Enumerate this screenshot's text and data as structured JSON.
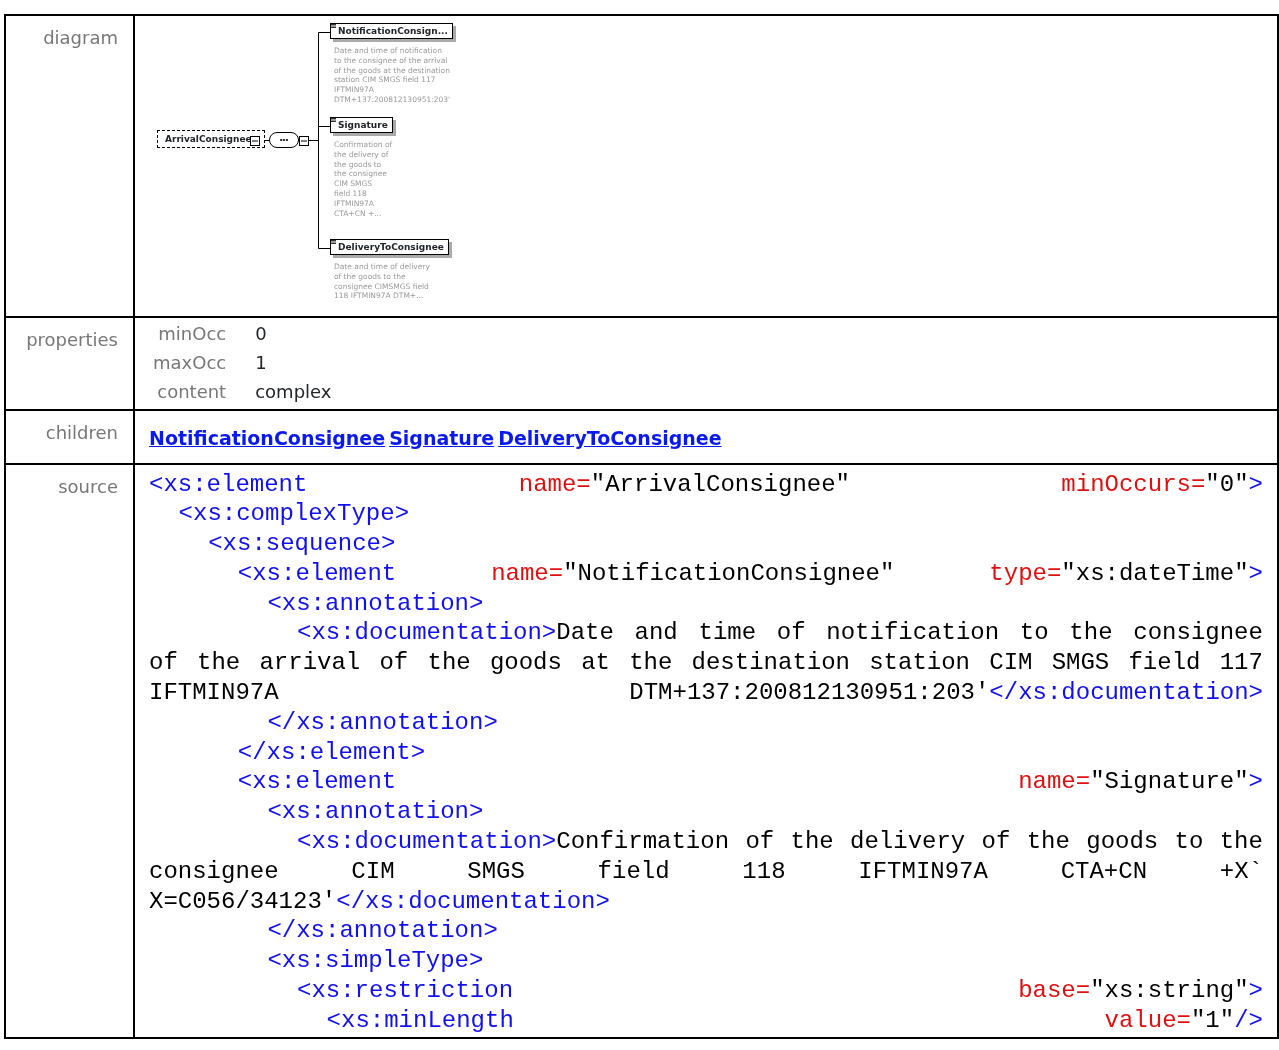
{
  "rows": [
    {
      "label": "diagram",
      "kind": "diagram",
      "diagram": {
        "root": {
          "name": "ArrivalConsignee"
        },
        "compositor": {
          "symbol": "•••"
        },
        "children": [
          {
            "name": "NotificationConsign...",
            "description_lines": [
              "Date and time of notification",
              "to the consignee of the arrival",
              "of the goods at the destination",
              "station CIM SMGS field 117",
              "IFTMIN97A",
              "DTM+137:200812130951:203'"
            ]
          },
          {
            "name": "Signature",
            "description_lines": [
              "Confirmation of",
              "the delivery of",
              "the goods to",
              "the consignee",
              "CIM SMGS",
              "field 118",
              "IFTMIN97A",
              "CTA+CN +..."
            ]
          },
          {
            "name": "DeliveryToConsignee",
            "description_lines": [
              "Date and time of delivery",
              "of the goods to the",
              "consignee CIMSMGS field",
              "118 IFTMIN97A DTM+..."
            ]
          }
        ]
      }
    },
    {
      "label": "properties",
      "kind": "properties",
      "properties": [
        {
          "name": "minOcc",
          "value": "0"
        },
        {
          "name": "maxOcc",
          "value": "1"
        },
        {
          "name": "content",
          "value": "complex"
        }
      ]
    },
    {
      "label": "children",
      "kind": "links",
      "links": [
        "NotificationConsignee",
        "Signature",
        "DeliveryToConsignee"
      ]
    },
    {
      "label": "source",
      "kind": "source",
      "source": {
        "head": [
          {
            "justify": true,
            "words": [
              [
                {
                  "kind": "tag",
                  "text": "<xs:element"
                }
              ],
              [
                {
                  "kind": "attr",
                  "text": "name="
                },
                {
                  "kind": "val",
                  "text": "\"ArrivalConsignee\""
                }
              ],
              [
                {
                  "kind": "attr",
                  "text": "minOccurs="
                },
                {
                  "kind": "val",
                  "text": "\"0\""
                },
                {
                  "kind": "tag",
                  "text": ">"
                }
              ]
            ]
          }
        ],
        "children": [
          {
            "head": [
              {
                "words": [
                  [
                    {
                      "kind": "tag",
                      "text": "<xs:complexType>"
                    }
                  ]
                ]
              }
            ],
            "children": [
              {
                "head": [
                  {
                    "words": [
                      [
                        {
                          "kind": "tag",
                          "text": "<xs:sequence>"
                        }
                      ]
                    ]
                  }
                ],
                "children": [
                  {
                    "head": [
                      {
                        "justify": true,
                        "words": [
                          [
                            {
                              "kind": "tag",
                              "text": "<xs:element"
                            }
                          ],
                          [
                            {
                              "kind": "attr",
                              "text": "name="
                            },
                            {
                              "kind": "val",
                              "text": "\"NotificationConsignee\""
                            }
                          ],
                          [
                            {
                              "kind": "attr",
                              "text": "type="
                            },
                            {
                              "kind": "val",
                              "text": "\"xs:dateTime\""
                            },
                            {
                              "kind": "tag",
                              "text": ">"
                            }
                          ]
                        ]
                      }
                    ],
                    "children": [
                      {
                        "head": [
                          {
                            "words": [
                              [
                                {
                                  "kind": "tag",
                                  "text": "<xs:annotation>"
                                }
                              ]
                            ]
                          }
                        ],
                        "children": [
                          {
                            "head": [
                              {
                                "justify": true,
                                "words": [
                                  [
                                    {
                                      "kind": "tag",
                                      "text": "<xs:documentation>"
                                    },
                                    {
                                      "kind": "val",
                                      "text": "Date"
                                    }
                                  ],
                                  [
                                    {
                                      "kind": "val",
                                      "text": "and"
                                    }
                                  ],
                                  [
                                    {
                                      "kind": "val",
                                      "text": "time"
                                    }
                                  ],
                                  [
                                    {
                                      "kind": "val",
                                      "text": "of"
                                    }
                                  ],
                                  [
                                    {
                                      "kind": "val",
                                      "text": "notification"
                                    }
                                  ],
                                  [
                                    {
                                      "kind": "val",
                                      "text": "to"
                                    }
                                  ],
                                  [
                                    {
                                      "kind": "val",
                                      "text": "the"
                                    }
                                  ],
                                  [
                                    {
                                      "kind": "val",
                                      "text": "consignee"
                                    }
                                  ]
                                ],
                                "wraps": [
                                  {
                                    "justify": true,
                                    "words": [
                                      [
                                        {
                                          "kind": "val",
                                          "text": "of"
                                        }
                                      ],
                                      [
                                        {
                                          "kind": "val",
                                          "text": "the"
                                        }
                                      ],
                                      [
                                        {
                                          "kind": "val",
                                          "text": "arrival"
                                        }
                                      ],
                                      [
                                        {
                                          "kind": "val",
                                          "text": "of"
                                        }
                                      ],
                                      [
                                        {
                                          "kind": "val",
                                          "text": "the"
                                        }
                                      ],
                                      [
                                        {
                                          "kind": "val",
                                          "text": "goods"
                                        }
                                      ],
                                      [
                                        {
                                          "kind": "val",
                                          "text": "at"
                                        }
                                      ],
                                      [
                                        {
                                          "kind": "val",
                                          "text": "the"
                                        }
                                      ],
                                      [
                                        {
                                          "kind": "val",
                                          "text": "destination"
                                        }
                                      ],
                                      [
                                        {
                                          "kind": "val",
                                          "text": "station"
                                        }
                                      ],
                                      [
                                        {
                                          "kind": "val",
                                          "text": "CIM"
                                        }
                                      ],
                                      [
                                        {
                                          "kind": "val",
                                          "text": "SMGS"
                                        }
                                      ],
                                      [
                                        {
                                          "kind": "val",
                                          "text": "field"
                                        }
                                      ],
                                      [
                                        {
                                          "kind": "val",
                                          "text": "117"
                                        }
                                      ]
                                    ]
                                  },
                                  {
                                    "justify": true,
                                    "words": [
                                      [
                                        {
                                          "kind": "val",
                                          "text": "IFTMIN97A"
                                        }
                                      ],
                                      [
                                        {
                                          "kind": "val",
                                          "text": "DTM+137:200812130951:203'"
                                        },
                                        {
                                          "kind": "tag",
                                          "text": "</xs:documentation>"
                                        }
                                      ]
                                    ]
                                  }
                                ]
                              }
                            ]
                          }
                        ],
                        "tail": [
                          {
                            "words": [
                              [
                                {
                                  "kind": "tag",
                                  "text": "</xs:annotation>"
                                }
                              ]
                            ]
                          }
                        ]
                      }
                    ],
                    "tail": [
                      {
                        "words": [
                          [
                            {
                              "kind": "tag",
                              "text": "</xs:element>"
                            }
                          ]
                        ]
                      }
                    ]
                  },
                  {
                    "head": [
                      {
                        "justify": true,
                        "words": [
                          [
                            {
                              "kind": "tag",
                              "text": "<xs:element"
                            }
                          ],
                          [
                            {
                              "kind": "attr",
                              "text": "name="
                            },
                            {
                              "kind": "val",
                              "text": "\"Signature\""
                            },
                            {
                              "kind": "tag",
                              "text": ">"
                            }
                          ]
                        ]
                      }
                    ],
                    "children": [
                      {
                        "head": [
                          {
                            "words": [
                              [
                                {
                                  "kind": "tag",
                                  "text": "<xs:annotation>"
                                }
                              ]
                            ]
                          }
                        ],
                        "children": [
                          {
                            "head": [
                              {
                                "justify": true,
                                "words": [
                                  [
                                    {
                                      "kind": "tag",
                                      "text": "<xs:documentation>"
                                    },
                                    {
                                      "kind": "val",
                                      "text": "Confirmation"
                                    }
                                  ],
                                  [
                                    {
                                      "kind": "val",
                                      "text": "of"
                                    }
                                  ],
                                  [
                                    {
                                      "kind": "val",
                                      "text": "the"
                                    }
                                  ],
                                  [
                                    {
                                      "kind": "val",
                                      "text": "delivery"
                                    }
                                  ],
                                  [
                                    {
                                      "kind": "val",
                                      "text": "of"
                                    }
                                  ],
                                  [
                                    {
                                      "kind": "val",
                                      "text": "the"
                                    }
                                  ],
                                  [
                                    {
                                      "kind": "val",
                                      "text": "goods"
                                    }
                                  ],
                                  [
                                    {
                                      "kind": "val",
                                      "text": "to"
                                    }
                                  ],
                                  [
                                    {
                                      "kind": "val",
                                      "text": "the"
                                    }
                                  ]
                                ],
                                "wraps": [
                                  {
                                    "justify": true,
                                    "words": [
                                      [
                                        {
                                          "kind": "val",
                                          "text": "consignee"
                                        }
                                      ],
                                      [
                                        {
                                          "kind": "val",
                                          "text": "CIM"
                                        }
                                      ],
                                      [
                                        {
                                          "kind": "val",
                                          "text": "SMGS"
                                        }
                                      ],
                                      [
                                        {
                                          "kind": "val",
                                          "text": "field"
                                        }
                                      ],
                                      [
                                        {
                                          "kind": "val",
                                          "text": "118"
                                        }
                                      ],
                                      [
                                        {
                                          "kind": "val",
                                          "text": "IFTMIN97A"
                                        }
                                      ],
                                      [
                                        {
                                          "kind": "val",
                                          "text": "CTA+CN"
                                        }
                                      ],
                                      [
                                        {
                                          "kind": "val",
                                          "text": "+X`"
                                        }
                                      ]
                                    ]
                                  },
                                  {
                                    "words": [
                                      [
                                        {
                                          "kind": "val",
                                          "text": "X=C056/34123'"
                                        },
                                        {
                                          "kind": "tag",
                                          "text": "</xs:documentation>"
                                        }
                                      ]
                                    ]
                                  }
                                ]
                              }
                            ]
                          }
                        ],
                        "tail": [
                          {
                            "words": [
                              [
                                {
                                  "kind": "tag",
                                  "text": "</xs:annotation>"
                                }
                              ]
                            ]
                          }
                        ]
                      },
                      {
                        "head": [
                          {
                            "words": [
                              [
                                {
                                  "kind": "tag",
                                  "text": "<xs:simpleType>"
                                }
                              ]
                            ]
                          }
                        ],
                        "children": [
                          {
                            "head": [
                              {
                                "justify": true,
                                "words": [
                                  [
                                    {
                                      "kind": "tag",
                                      "text": "<xs:restriction"
                                    }
                                  ],
                                  [
                                    {
                                      "kind": "attr",
                                      "text": "base="
                                    },
                                    {
                                      "kind": "val",
                                      "text": "\"xs:string\""
                                    },
                                    {
                                      "kind": "tag",
                                      "text": ">"
                                    }
                                  ]
                                ]
                              }
                            ],
                            "children": [
                              {
                                "head": [
                                  {
                                    "justify": true,
                                    "words": [
                                      [
                                        {
                                          "kind": "tag",
                                          "text": "<xs:minLength"
                                        }
                                      ],
                                      [
                                        {
                                          "kind": "attr",
                                          "text": "value="
                                        },
                                        {
                                          "kind": "val",
                                          "text": "\"1\""
                                        },
                                        {
                                          "kind": "tag",
                                          "text": "/>"
                                        }
                                      ]
                                    ]
                                  }
                                ]
                              }
                            ]
                          }
                        ]
                      }
                    ]
                  }
                ]
              }
            ]
          }
        ]
      }
    }
  ]
}
